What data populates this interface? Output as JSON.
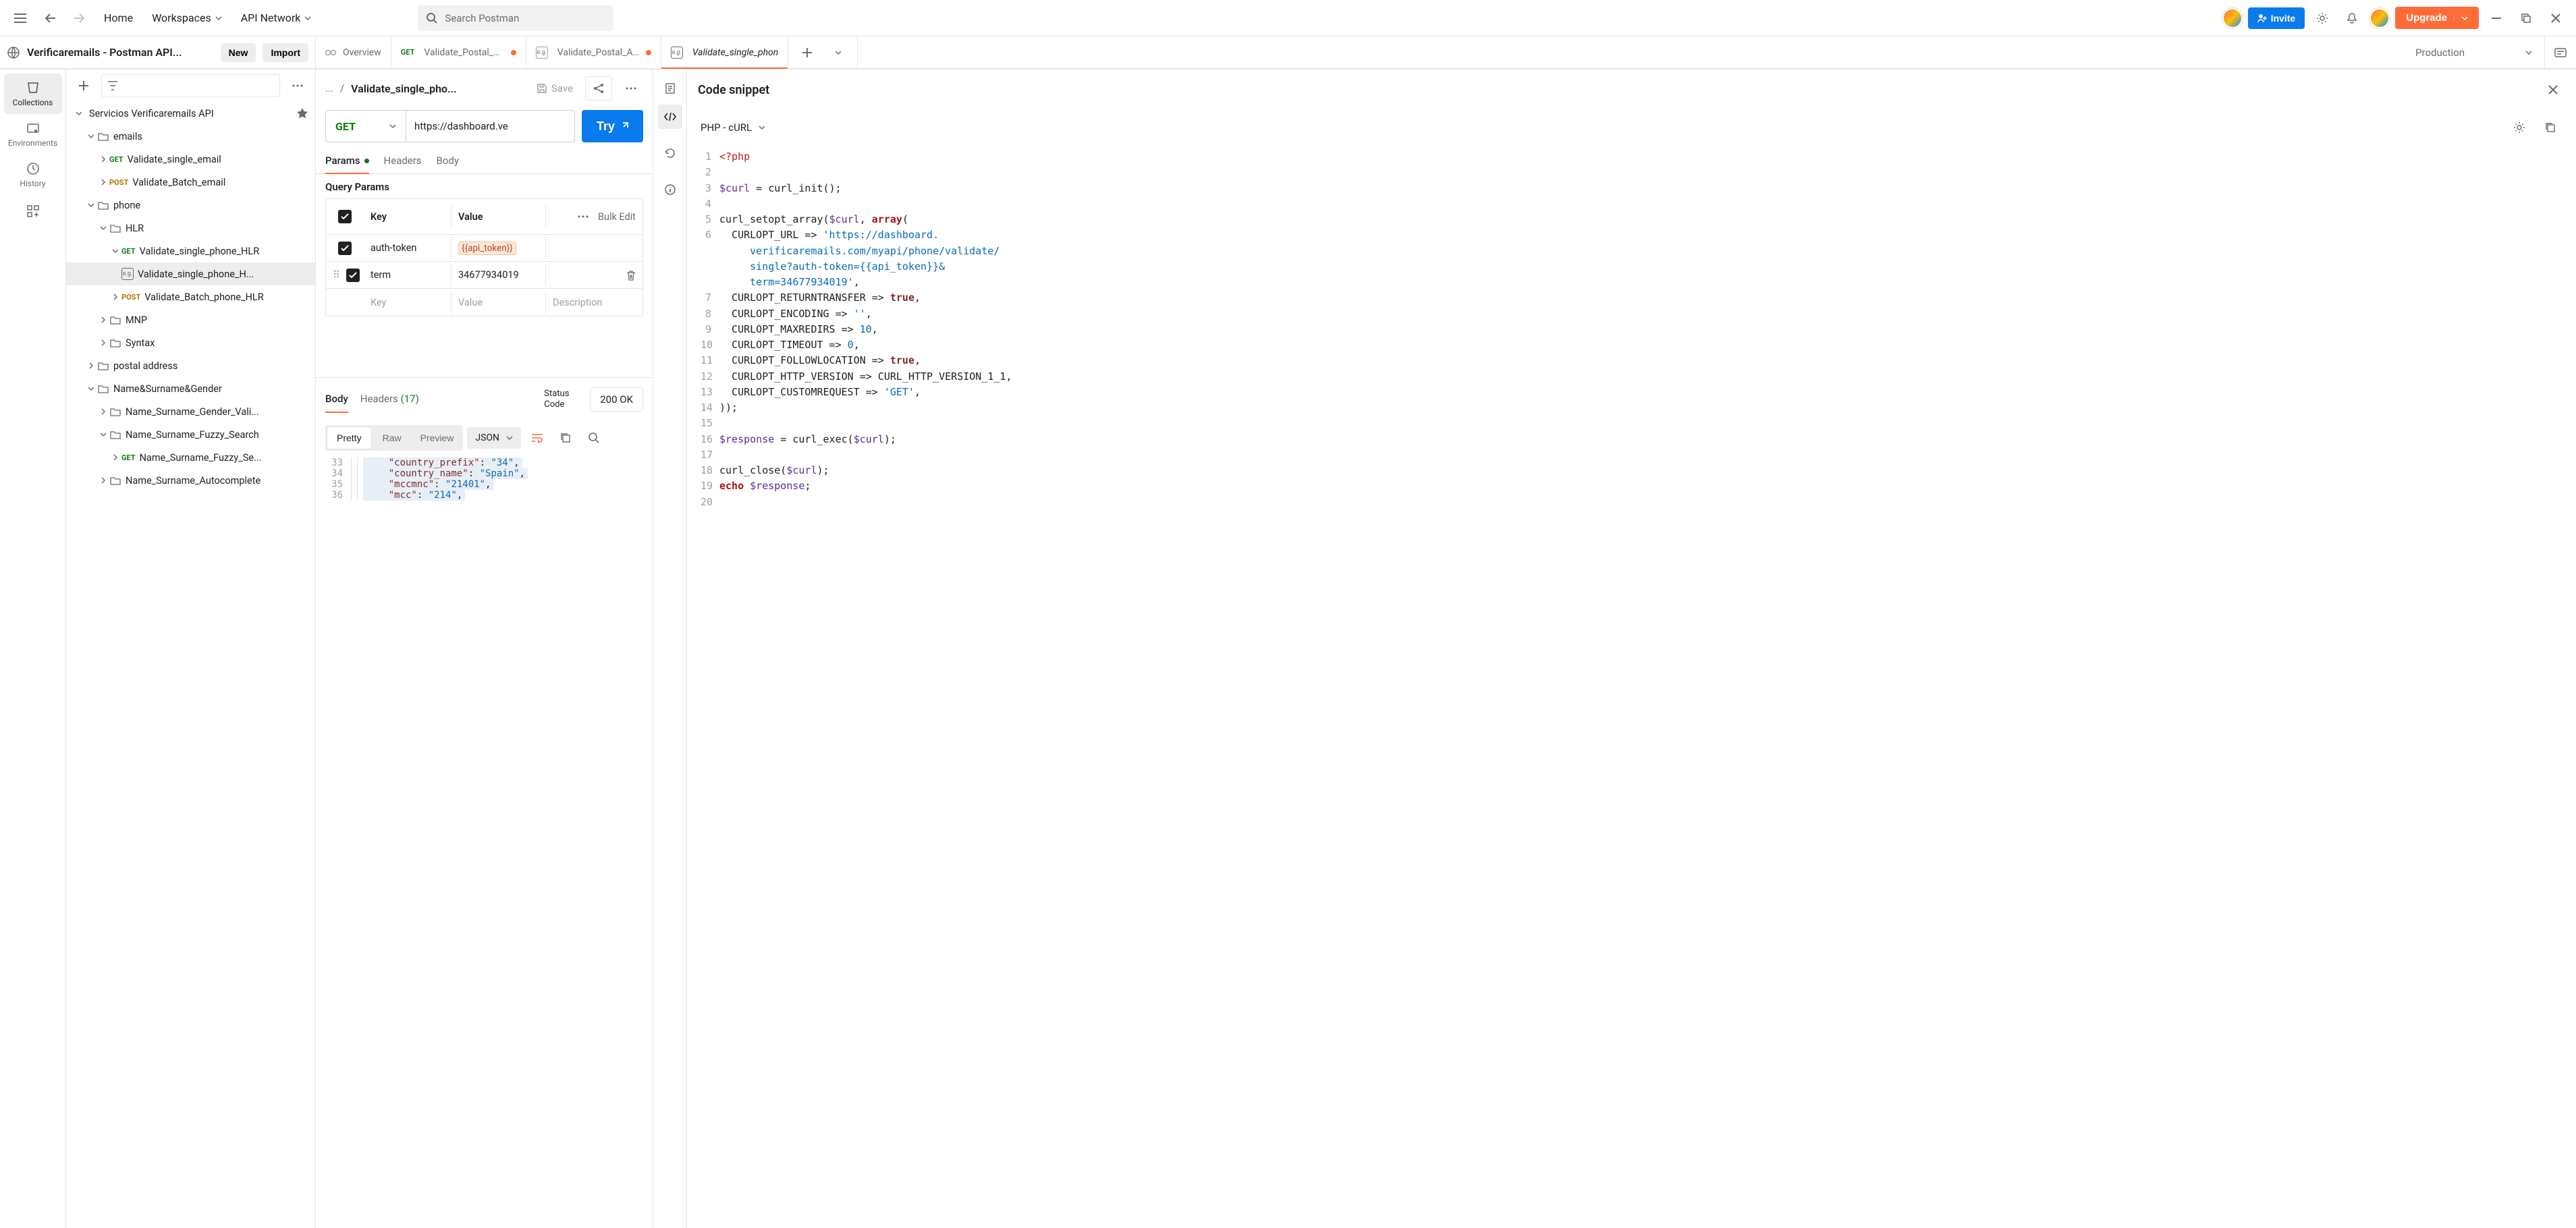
{
  "topbar": {
    "home": "Home",
    "workspaces": "Workspaces",
    "api_network": "API Network",
    "search_placeholder": "Search Postman",
    "invite": "Invite",
    "upgrade": "Upgrade"
  },
  "workspace": {
    "title": "Verificaremails - Postman API...",
    "new_btn": "New",
    "import_btn": "Import"
  },
  "leftnav": {
    "collections": "Collections",
    "environments": "Environments",
    "history": "History"
  },
  "tree": {
    "root": "Servicios Verificaremails API",
    "emails": "emails",
    "validate_single_email": "Validate_single_email",
    "validate_batch_email": "Validate_Batch_email",
    "phone": "phone",
    "hlr": "HLR",
    "validate_single_phone_hlr": "Validate_single_phone_HLR",
    "validate_single_phone_h_eg": "Validate_single_phone_H...",
    "validate_batch_phone_hlr": "Validate_Batch_phone_HLR",
    "mnp": "MNP",
    "syntax": "Syntax",
    "postal_address": "postal address",
    "name_surname_gender": "Name&Surname&Gender",
    "ns_gender_vali": "Name_Surname_Gender_Vali...",
    "ns_fuzzy_search": "Name_Surname_Fuzzy_Search",
    "ns_fuzzy_se_get": "Name_Surname_Fuzzy_Se...",
    "ns_autocomplete": "Name_Surname_Autocomplete"
  },
  "tabs": {
    "overview": "Overview",
    "t1_method": "GET",
    "t1_label": "Validate_Postal_Adc",
    "t2_label": "Validate_Postal_Adc",
    "t3_label": "Validate_single_phon"
  },
  "env": {
    "name": "Production"
  },
  "request": {
    "crumb": "...",
    "title": "Validate_single_pho...",
    "save": "Save",
    "method": "GET",
    "url": "https://dashboard.ve",
    "try": "Try",
    "subtabs": {
      "params": "Params",
      "headers": "Headers",
      "body": "Body"
    },
    "query_params_title": "Query Params",
    "table": {
      "hdr_key": "Key",
      "hdr_value": "Value",
      "bulk": "Bulk Edit",
      "rows": [
        {
          "key": "auth-token",
          "value": "{{api_token}}"
        },
        {
          "key": "term",
          "value": "34677934019"
        }
      ],
      "ph_key": "Key",
      "ph_value": "Value",
      "ph_desc": "Description"
    }
  },
  "response": {
    "body": "Body",
    "headers": "Headers",
    "headers_count": "(17)",
    "status_label": "Status Code",
    "status_value": "200 OK",
    "pretty": "Pretty",
    "raw": "Raw",
    "preview": "Preview",
    "format": "JSON",
    "json_lines": [
      {
        "n": "33",
        "k": "\"country_prefix\"",
        "v": "\"34\""
      },
      {
        "n": "34",
        "k": "\"country_name\"",
        "v": "\"Spain\""
      },
      {
        "n": "35",
        "k": "\"mccmnc\"",
        "v": "\"21401\""
      },
      {
        "n": "36",
        "k": "\"mcc\"",
        "v": "\"214\""
      }
    ]
  },
  "snippet": {
    "title": "Code snippet",
    "lang": "PHP - cURL",
    "lines": [
      {
        "n": "1",
        "html": "<span class='c-tag'>&lt;?php</span>"
      },
      {
        "n": "2",
        "html": ""
      },
      {
        "n": "3",
        "html": "<span class='c-varh'>$curl</span> = curl_init();"
      },
      {
        "n": "4",
        "html": ""
      },
      {
        "n": "5",
        "html": "curl_setopt_array(<span class='c-varh'>$curl</span>, <span class='c-kw'>array</span>("
      },
      {
        "n": "6",
        "html": "  CURLOPT_URL =&gt; <span class='c-str'>'https://dashboard.</span>"
      },
      {
        "n": "",
        "html": "     <span class='c-str'>verificaremails.com/myapi/phone/validate/</span>"
      },
      {
        "n": "",
        "html": "     <span class='c-str'>single?auth-token={{api_token}}&amp;</span>"
      },
      {
        "n": "",
        "html": "     <span class='c-str'>term=34677934019'</span>,"
      },
      {
        "n": "7",
        "html": "  CURLOPT_RETURNTRANSFER =&gt; <span class='c-bool'>true</span>,"
      },
      {
        "n": "8",
        "html": "  CURLOPT_ENCODING =&gt; <span class='c-str'>''</span>,"
      },
      {
        "n": "9",
        "html": "  CURLOPT_MAXREDIRS =&gt; <span class='c-num'>10</span>,"
      },
      {
        "n": "10",
        "html": "  CURLOPT_TIMEOUT =&gt; <span class='c-num'>0</span>,"
      },
      {
        "n": "11",
        "html": "  CURLOPT_FOLLOWLOCATION =&gt; <span class='c-bool'>true</span>,"
      },
      {
        "n": "12",
        "html": "  CURLOPT_HTTP_VERSION =&gt; CURL_HTTP_VERSION_1_1,"
      },
      {
        "n": "13",
        "html": "  CURLOPT_CUSTOMREQUEST =&gt; <span class='c-str'>'GET'</span>,"
      },
      {
        "n": "14",
        "html": "));"
      },
      {
        "n": "15",
        "html": ""
      },
      {
        "n": "16",
        "html": "<span class='c-varh'>$response</span> = curl_exec(<span class='c-varh'>$curl</span>);"
      },
      {
        "n": "17",
        "html": ""
      },
      {
        "n": "18",
        "html": "curl_close(<span class='c-varh'>$curl</span>);"
      },
      {
        "n": "19",
        "html": "<span class='c-kw'>echo</span> <span class='c-varh'>$response</span>;"
      },
      {
        "n": "20",
        "html": ""
      }
    ]
  }
}
